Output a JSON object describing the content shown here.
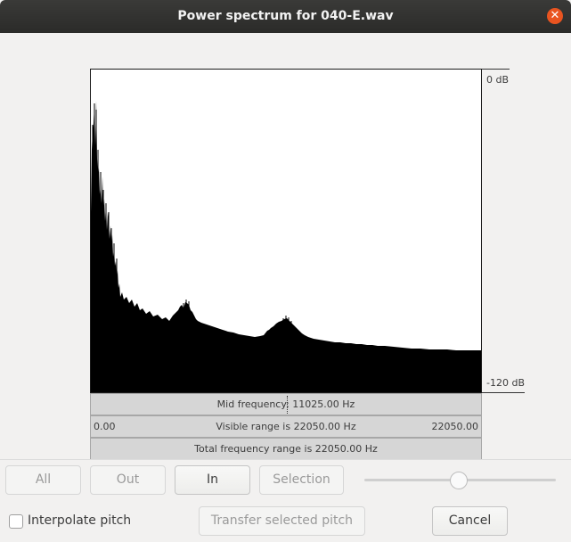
{
  "window": {
    "title": "Power spectrum for 040-E.wav"
  },
  "plot": {
    "y_top_label": "0 dB",
    "y_bottom_label": "-120 dB"
  },
  "rulers": {
    "mid_frequency": "Mid frequency: 11025.00 Hz",
    "visible_range": "Visible range is 22050.00 Hz",
    "range_start": "0.00",
    "range_end": "22050.00",
    "total_range": "Total frequency range is 22050.00 Hz"
  },
  "zoom": {
    "all_label": "All",
    "out_label": "Out",
    "in_label": "In",
    "selection_label": "Selection",
    "slider_value": 0.5
  },
  "footer": {
    "interpolate_label": "Interpolate pitch",
    "interpolate_checked": false,
    "transfer_label": "Transfer selected pitch",
    "cancel_label": "Cancel"
  },
  "icons": {
    "close": "close-icon"
  },
  "colors": {
    "close_accent": "#e95420",
    "spectrum_fill": "#000000"
  }
}
